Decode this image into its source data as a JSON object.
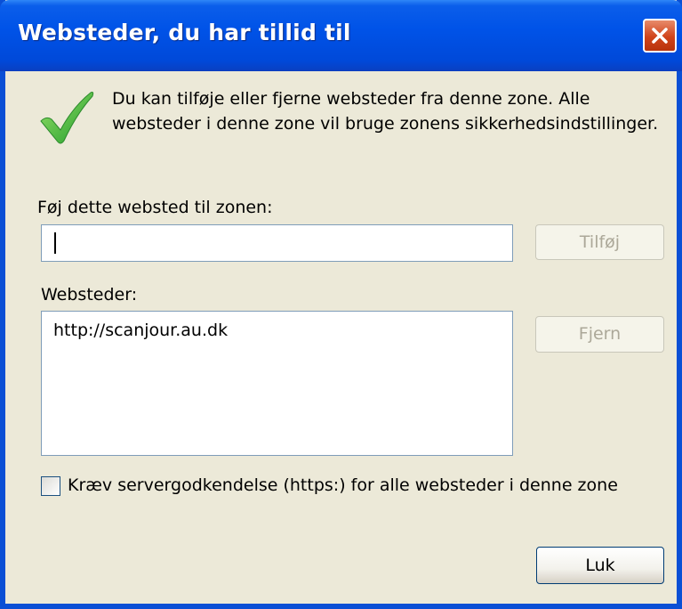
{
  "window": {
    "title": "Websteder, du har tillid til",
    "close_icon": "close-icon",
    "accent": "#0053E8",
    "close_color": "#D0431A"
  },
  "info": {
    "icon": "checkmark-icon",
    "text": "Du kan tilføje eller fjerne websteder fra denne zone. Alle websteder i denne zone vil bruge zonens sikkerhedsindstillinger."
  },
  "add_site": {
    "label": "Føj dette websted til zonen:",
    "value": "",
    "add_button": "Tilføj"
  },
  "websites": {
    "label": "Websteder:",
    "items": [
      "http://scanjour.au.dk"
    ],
    "remove_button": "Fjern"
  },
  "require_https": {
    "label": "Kræv servergodkendelse (https:) for alle websteder i denne zone",
    "checked": false
  },
  "close_button": "Luk"
}
